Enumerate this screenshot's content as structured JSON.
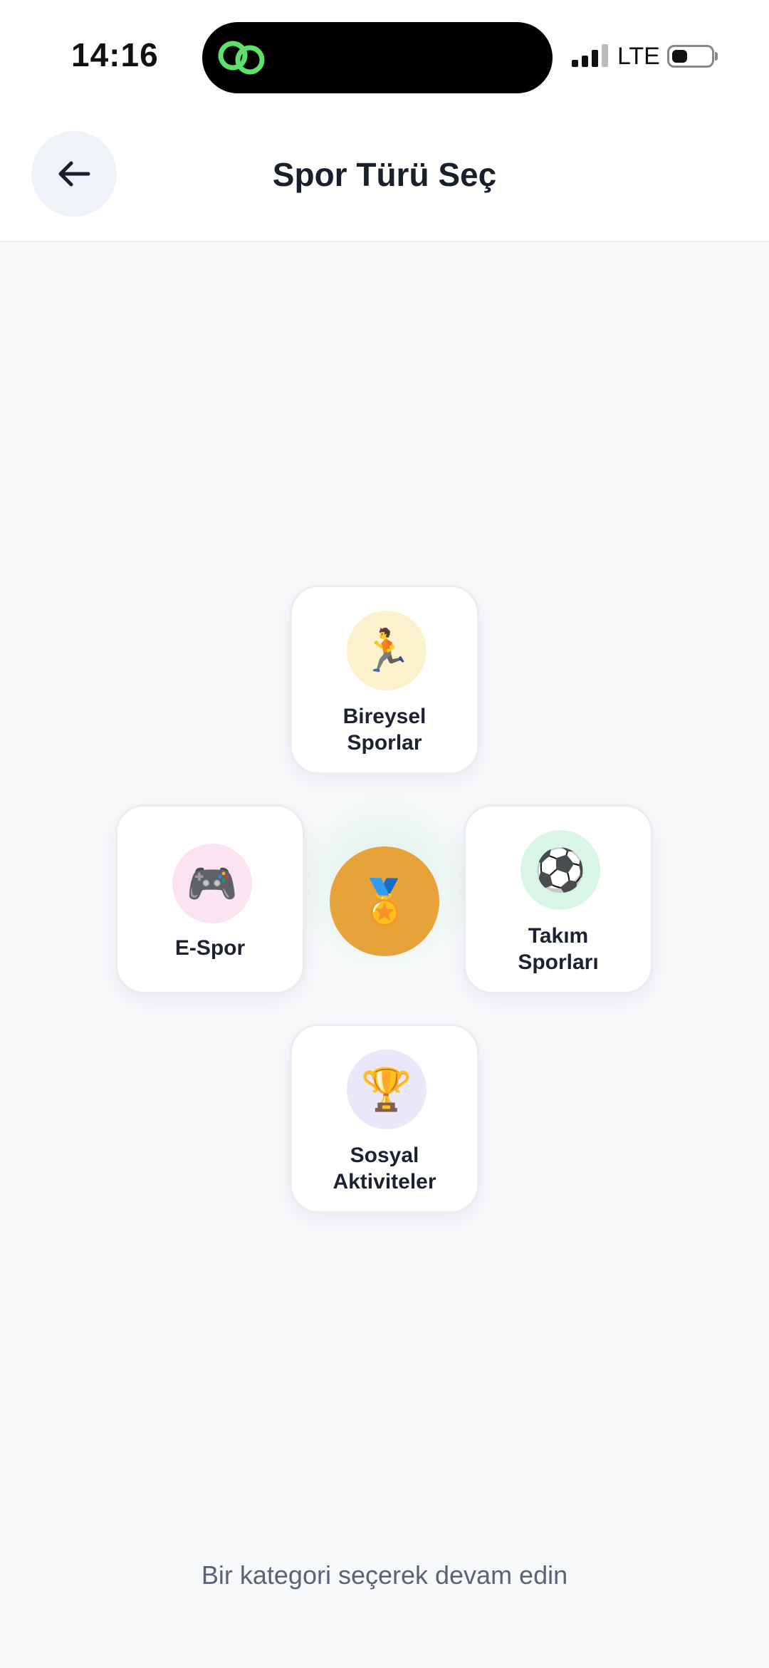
{
  "status_bar": {
    "time": "14:16",
    "carrier": "LTE",
    "battery_level_percent": 40,
    "island_app_icon": "link-rings-icon"
  },
  "header": {
    "title": "Spor Türü Seç",
    "back_icon": "arrow-left-icon"
  },
  "categories": [
    {
      "id": "bireysel",
      "label_line1": "Bireysel",
      "label_line2": "Sporlar",
      "emoji": "🏃",
      "icon_bg": "#fcf1cc"
    },
    {
      "id": "espor",
      "label_line1": "E-Spor",
      "label_line2": "",
      "emoji": "🎮",
      "icon_bg": "#fbe4ef"
    },
    {
      "id": "takim",
      "label_line1": "Takım",
      "label_line2": "Sporları",
      "emoji": "⚽",
      "icon_bg": "#d8f6e5"
    },
    {
      "id": "sosyal",
      "label_line1": "Sosyal",
      "label_line2": "Aktiviteler",
      "emoji": "🏆",
      "icon_bg": "#ebe7fb"
    }
  ],
  "center": {
    "emoji": "🏅",
    "color": "#e8a23a"
  },
  "hint": "Bir kategori seçerek devam edin"
}
